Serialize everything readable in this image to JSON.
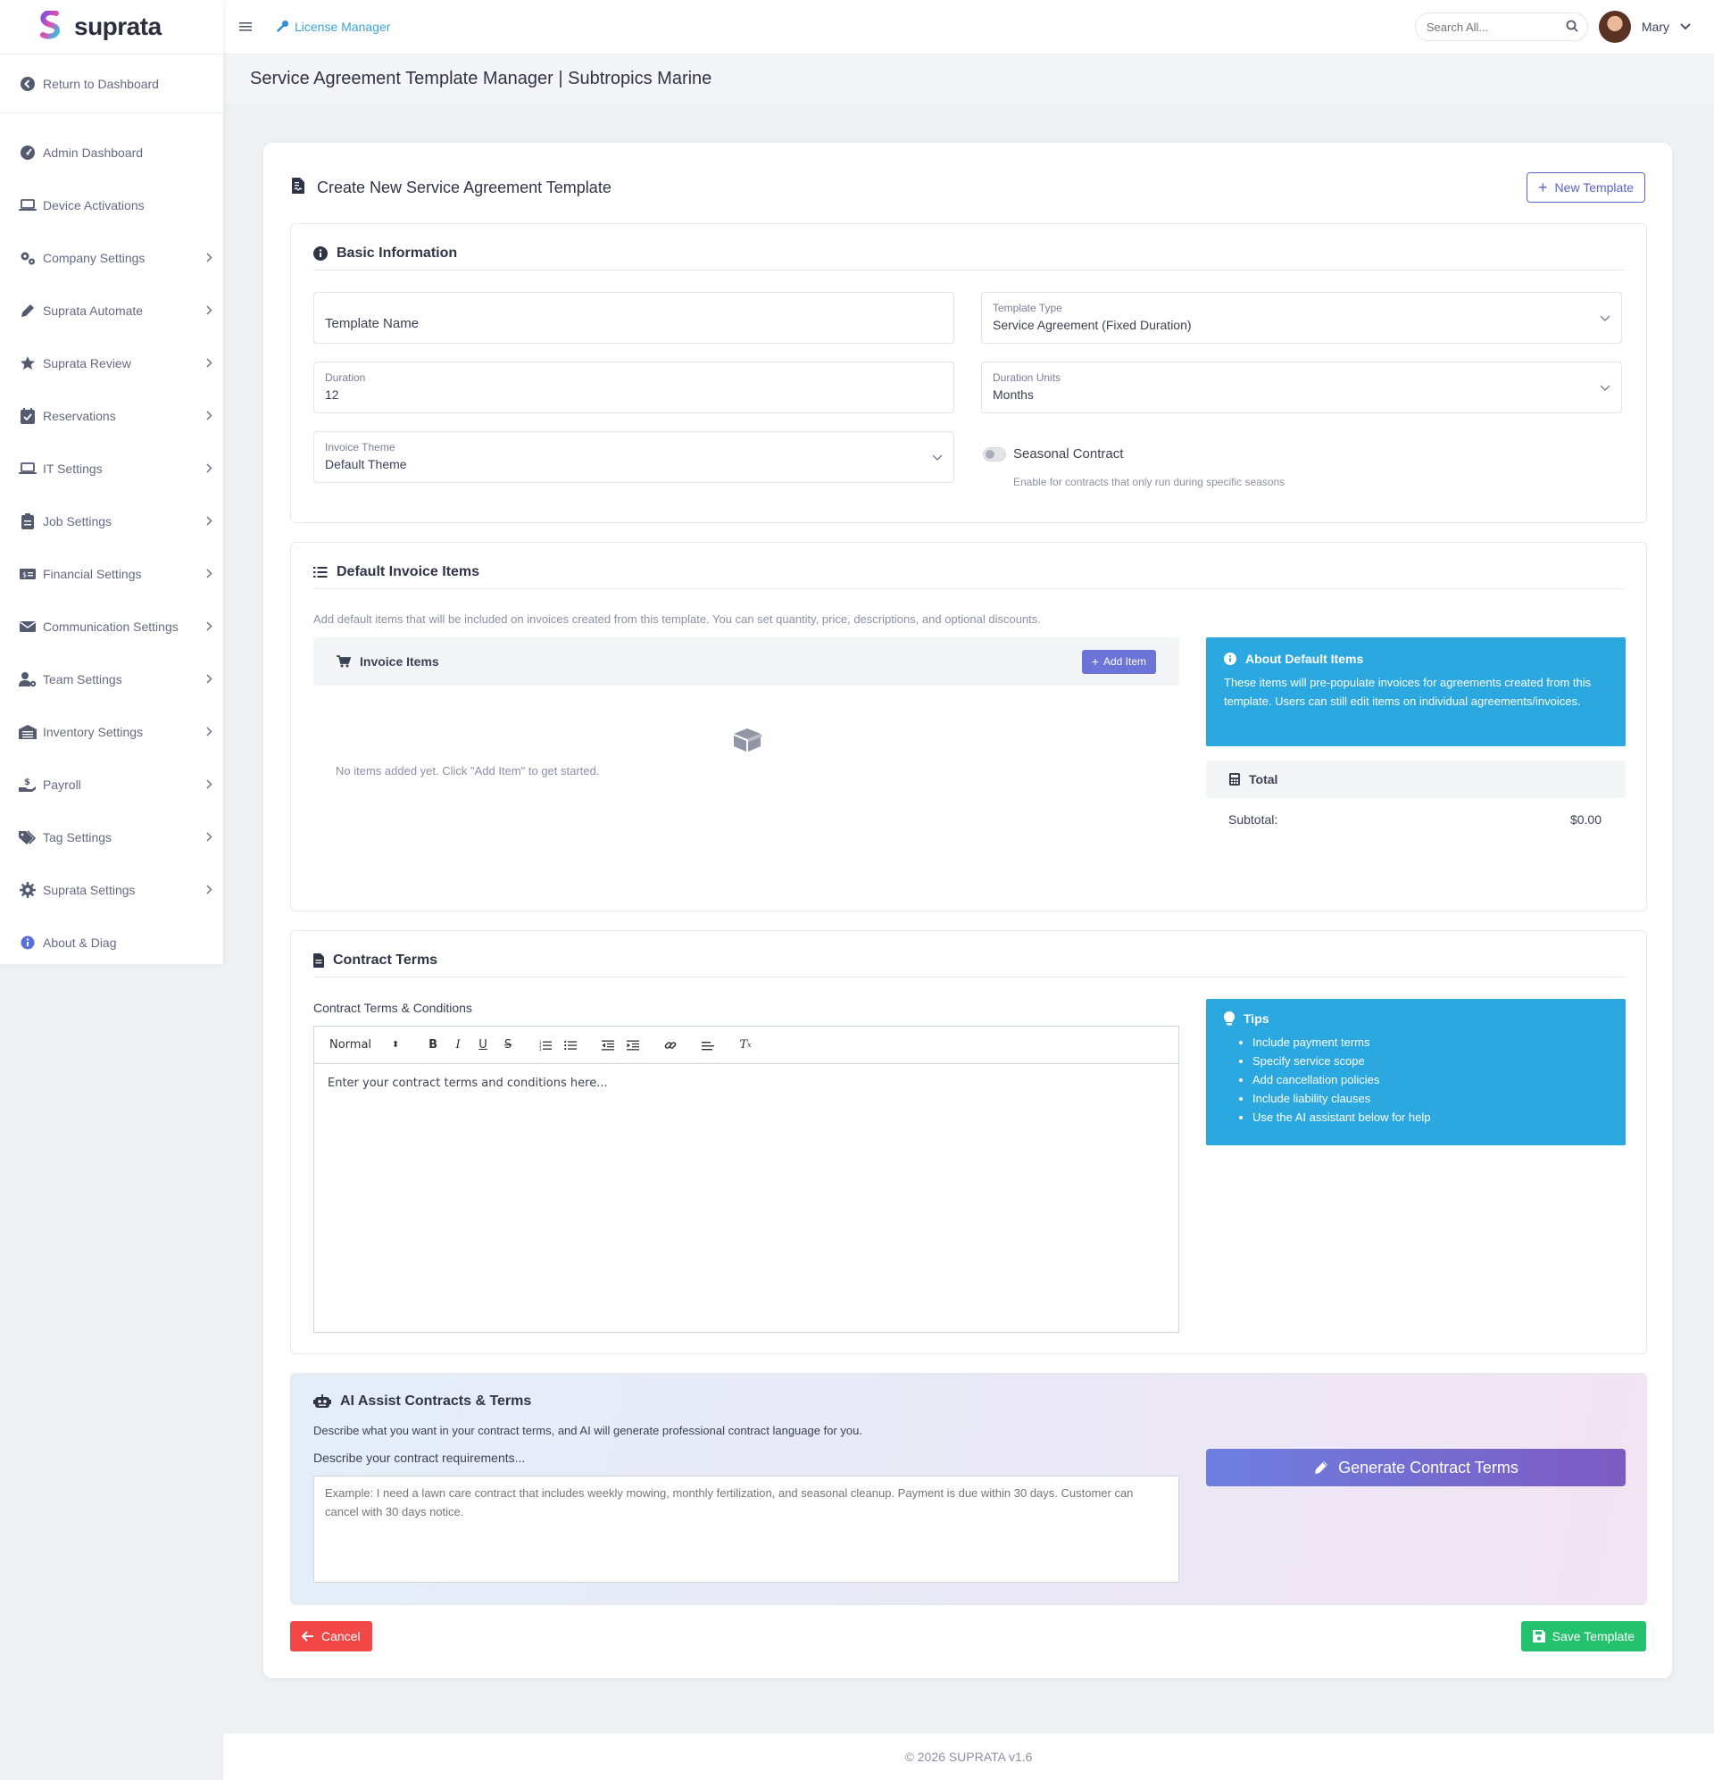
{
  "brand": {
    "name": "suprata"
  },
  "sidebar": {
    "return_label": "Return to Dashboard",
    "items": [
      {
        "label": "Admin Dashboard",
        "icon": "gauge-icon",
        "has_submenu": false
      },
      {
        "label": "Device Activations",
        "icon": "laptop-icon",
        "has_submenu": false
      },
      {
        "label": "Company Settings",
        "icon": "gears-icon",
        "has_submenu": true
      },
      {
        "label": "Suprata Automate",
        "icon": "pen-icon",
        "has_submenu": true
      },
      {
        "label": "Suprata Review",
        "icon": "star-icon",
        "has_submenu": true
      },
      {
        "label": "Reservations",
        "icon": "calendar-check-icon",
        "has_submenu": true
      },
      {
        "label": "IT Settings",
        "icon": "laptop-icon",
        "has_submenu": true
      },
      {
        "label": "Job Settings",
        "icon": "clipboard-icon",
        "has_submenu": true
      },
      {
        "label": "Financial Settings",
        "icon": "money-card-icon",
        "has_submenu": true
      },
      {
        "label": "Communication Settings",
        "icon": "envelope-icon",
        "has_submenu": true
      },
      {
        "label": "Team Settings",
        "icon": "user-gear-icon",
        "has_submenu": true
      },
      {
        "label": "Inventory Settings",
        "icon": "warehouse-icon",
        "has_submenu": true
      },
      {
        "label": "Payroll",
        "icon": "hand-dollar-icon",
        "has_submenu": true
      },
      {
        "label": "Tag Settings",
        "icon": "tags-icon",
        "has_submenu": true
      },
      {
        "label": "Suprata Settings",
        "icon": "gear-icon",
        "has_submenu": true
      },
      {
        "label": "About & Diag",
        "icon": "info-icon",
        "has_submenu": false
      }
    ]
  },
  "topbar": {
    "breadcrumb": "License Manager",
    "search_placeholder": "Search All...",
    "user_name": "Mary"
  },
  "page": {
    "title": "Service Agreement Template Manager | Subtropics Marine"
  },
  "card": {
    "title": "Create New Service Agreement Template",
    "new_template_label": "New Template"
  },
  "basic_info": {
    "title": "Basic Information",
    "template_name_placeholder": "Template Name",
    "template_type_label": "Template Type",
    "template_type_value": "Service Agreement (Fixed Duration)",
    "duration_label": "Duration",
    "duration_value": "12",
    "duration_units_label": "Duration Units",
    "duration_units_value": "Months",
    "invoice_theme_label": "Invoice Theme",
    "invoice_theme_value": "Default Theme",
    "seasonal_label": "Seasonal Contract",
    "seasonal_help": "Enable for contracts that only run during specific seasons",
    "seasonal_enabled": false
  },
  "invoice_items": {
    "title": "Default Invoice Items",
    "description": "Add default items that will be included on invoices created from this template. You can set quantity, price, descriptions, and optional discounts.",
    "bar_label": "Invoice Items",
    "add_label": "Add Item",
    "empty_text": "No items added yet. Click \"Add Item\" to get started.",
    "about_title": "About Default Items",
    "about_text": "These items will pre-populate invoices for agreements created from this template. Users can still edit items on individual agreements/invoices.",
    "total_label": "Total",
    "subtotal_label": "Subtotal:",
    "subtotal_value": "$0.00"
  },
  "contract_terms": {
    "title": "Contract Terms",
    "field_label": "Contract Terms & Conditions",
    "format_value": "Normal",
    "placeholder": "Enter your contract terms and conditions here...",
    "tips_title": "Tips",
    "tips": [
      "Include payment terms",
      "Specify service scope",
      "Add cancellation policies",
      "Include liability clauses",
      "Use the AI assistant below for help"
    ]
  },
  "ai_assist": {
    "title": "AI Assist Contracts & Terms",
    "description": "Describe what you want in your contract terms, and AI will generate professional contract language for you.",
    "input_label": "Describe your contract requirements...",
    "placeholder": "Example: I need a lawn care contract that includes weekly mowing, monthly fertilization, and seasonal cleanup. Payment is due within 30 days. Customer can cancel with 30 days notice.",
    "generate_label": "Generate Contract Terms"
  },
  "actions": {
    "cancel_label": "Cancel",
    "save_label": "Save Template"
  },
  "footer": {
    "text": "© 2026 SUPRATA v1.6"
  },
  "colors": {
    "accent": "#5b63c9",
    "info": "#2ba8e0",
    "danger": "#f24747",
    "success": "#25c26d",
    "link": "#3aa4dc"
  }
}
